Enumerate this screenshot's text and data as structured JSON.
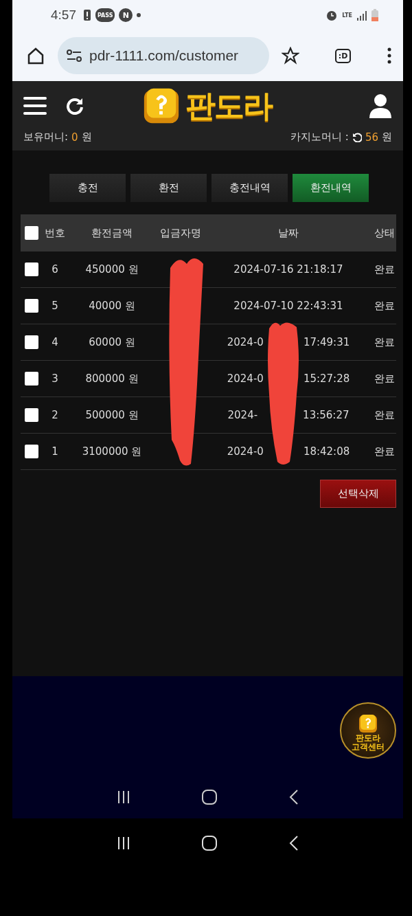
{
  "status_bar": {
    "time": "4:57",
    "badges": [
      "PASS",
      "N"
    ],
    "network": "LTE"
  },
  "browser": {
    "url": "pdr-1111.com/customer",
    "tab_count": ":D"
  },
  "header": {
    "logo_text": "판도라",
    "wallet": {
      "label": "보유머니:",
      "amount": "0",
      "unit": "원"
    },
    "casino": {
      "label": "카지노머니 :",
      "amount": "56",
      "unit": "원"
    }
  },
  "tabs": [
    {
      "label": "충전",
      "selected": false
    },
    {
      "label": "환전",
      "selected": false
    },
    {
      "label": "충전내역",
      "selected": false
    },
    {
      "label": "환전내역",
      "selected": true
    }
  ],
  "table": {
    "select_all": {
      "checked": false
    },
    "columns": [
      "번호",
      "환전금액",
      "입금자명",
      "날짜",
      "상태"
    ],
    "rows": [
      {
        "checked": false,
        "number": "6",
        "amount": "450000 원",
        "date": "2024-07-16 21:18:17",
        "status": "완료"
      },
      {
        "checked": false,
        "number": "5",
        "amount": "40000 원",
        "date": "2024-07-10 22:43:31",
        "status": "완료"
      },
      {
        "checked": false,
        "number": "4",
        "amount": "60000 원",
        "date_start": "2024-0",
        "date_end": "17:49:31",
        "status": "완료"
      },
      {
        "checked": false,
        "number": "3",
        "amount": "800000 원",
        "date_start": "2024-0",
        "date_end": "15:27:28",
        "status": "완료"
      },
      {
        "checked": false,
        "number": "2",
        "amount": "500000 원",
        "date_start": "2024-",
        "date_end": "13:56:27",
        "status": "완료"
      },
      {
        "checked": false,
        "number": "1",
        "amount": "3100000 원",
        "date_start": "2024-0",
        "date_end": "18:42:08",
        "status": "완료"
      }
    ]
  },
  "delete_button": "선택삭제",
  "help_badge": {
    "title": "판도라",
    "subtitle": "고객센터"
  }
}
